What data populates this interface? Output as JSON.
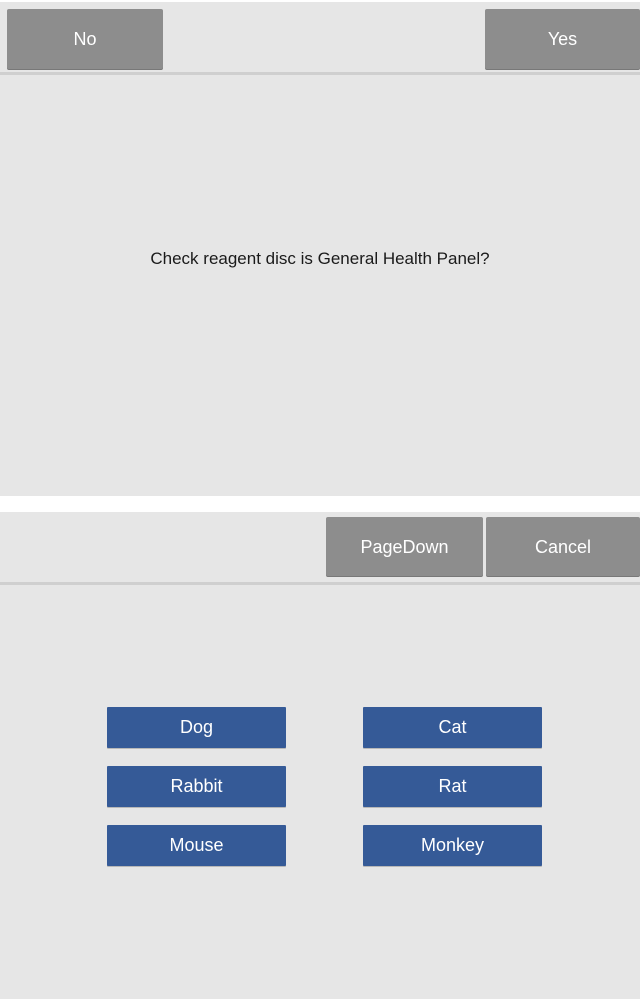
{
  "confirm_dialog": {
    "no_label": "No",
    "yes_label": "Yes",
    "question": "Check reagent disc is General Health Panel?"
  },
  "species_dialog": {
    "pagedown_label": "PageDown",
    "cancel_label": "Cancel",
    "species": [
      "Dog",
      "Cat",
      "Rabbit",
      "Rat",
      "Mouse",
      "Monkey"
    ]
  },
  "colors": {
    "panel_bg": "#e6e6e6",
    "toolbar_button": "#8d8d8d",
    "species_button": "#355a97",
    "divider": "#cfcfcf"
  }
}
